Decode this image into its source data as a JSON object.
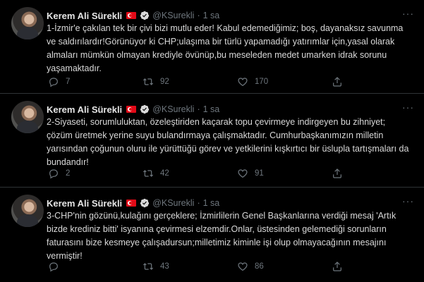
{
  "colors": {
    "background": "#000000",
    "text": "#d9d9d9",
    "muted": "#6e767d",
    "divider": "#2f3336",
    "flag": "#e30a17"
  },
  "tweets": [
    {
      "name": "Kerem Ali Sürekli",
      "handle": "@KSurekli",
      "dot": "·",
      "time": "1 sa",
      "text": "1-İzmir'e çakılan tek bir çivi bizi mutlu eder! Kabul edemediğimiz; boş, dayanaksız savunma ve saldırılardır!Görünüyor ki CHP;ulaşıma bir türlü yapamadığı yatırımlar için,yasal olarak almaları mümkün olmayan krediyle övünüp,bu meseleden medet umarken idrak sorunu yaşamaktadır.",
      "replies": "7",
      "retweets": "92",
      "likes": "170"
    },
    {
      "name": "Kerem Ali Sürekli",
      "handle": "@KSurekli",
      "dot": "·",
      "time": "1 sa",
      "text": "2-Siyaseti, sorumluluktan, özeleştiriden kaçarak topu çevirmeye indirgeyen bu zihniyet; çözüm üretmek yerine suyu bulandırmaya çalışmaktadır. Cumhurbaşkanımızın milletin yarısından çoğunun oluru ile yürüttüğü görev ve yetkilerini kışkırtıcı bir üslupla tartışmaları da bundandır!",
      "replies": "2",
      "retweets": "42",
      "likes": "91"
    },
    {
      "name": "Kerem Ali Sürekli",
      "handle": "@KSurekli",
      "dot": "·",
      "time": "1 sa",
      "text": "3-CHP'nin gözünü,kulağını gerçeklere; İzmirlilerin Genel Başkanlarına verdiği mesaj 'Artık bizde krediniz bitti' isyanına çevirmesi elzemdir.Onlar, üstesinden gelemediği sorunların faturasını bize kesmeye çalışadursun;milletimiz kiminle işi olup olmayacağının mesajını vermiştir!",
      "replies": "",
      "retweets": "43",
      "likes": "86"
    }
  ]
}
